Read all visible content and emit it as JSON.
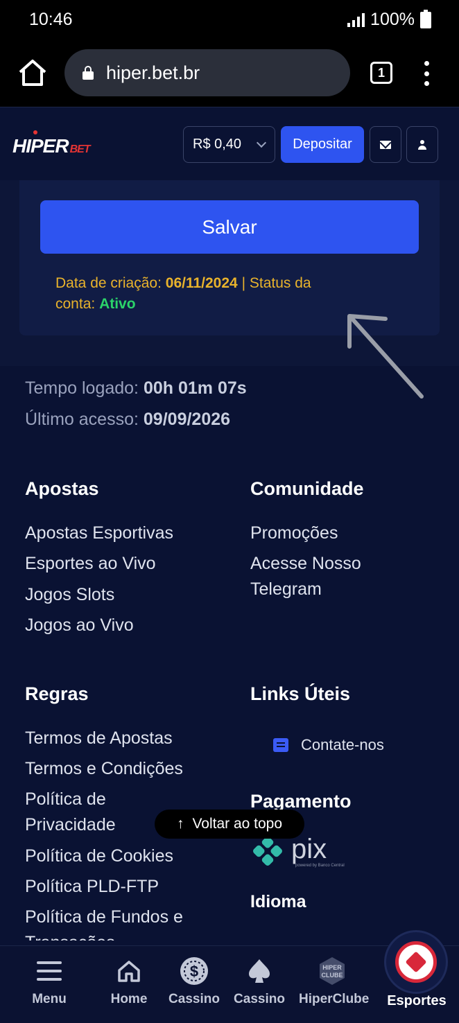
{
  "status_bar": {
    "time": "10:46",
    "battery": "100%"
  },
  "browser": {
    "url": "hiper.bet.br",
    "tab_count": "1"
  },
  "header": {
    "logo_main": "HIPER",
    "logo_sub": "BET",
    "balance": "R$ 0,40",
    "deposit_label": "Depositar"
  },
  "account_card": {
    "save_label": "Salvar",
    "creation_label": "Data de criação:",
    "creation_date": "06/11/2024",
    "separator": "|",
    "status_label_1": "Status da",
    "status_label_2": "conta:",
    "status_value": "Ativo"
  },
  "session": {
    "logged_label": "Tempo logado:",
    "logged_value": "00h 01m 07s",
    "last_access_label": "Último acesso:",
    "last_access_value": "09/09/2026"
  },
  "footer": {
    "apostas": {
      "title": "Apostas",
      "links": [
        "Apostas Esportivas",
        "Esportes ao Vivo",
        "Jogos Slots",
        "Jogos ao Vivo"
      ]
    },
    "comunidade": {
      "title": "Comunidade",
      "links": [
        "Promoções",
        "Acesse Nosso",
        "Telegram"
      ]
    },
    "regras": {
      "title": "Regras",
      "links": [
        "Termos de Apostas",
        "Termos e Condições",
        "Política de",
        "Privacidade",
        "Política de Cookies",
        "Política PLD-FTP",
        "Política de Fundos e",
        "Transações"
      ]
    },
    "links_uteis": {
      "title": "Links Úteis",
      "contact": "Contate-nos"
    },
    "pagamento": {
      "title": "Pagamento",
      "pix": "pix",
      "pix_sub": "powered by Banco Central"
    },
    "idioma": {
      "title": "Idioma"
    },
    "back_to_top": "Voltar ao topo"
  },
  "bottom_nav": {
    "items": [
      "Menu",
      "Home",
      "Cassino",
      "Cassino",
      "HiperClube",
      "Esportes"
    ],
    "club_badge": [
      "HIPER",
      "CLUBE"
    ]
  },
  "colors": {
    "background": "#0a1233",
    "accent_blue": "#2e54f0",
    "warning_yellow": "#e9b32c",
    "status_green": "#2bd46a",
    "brand_red": "#e53434"
  }
}
